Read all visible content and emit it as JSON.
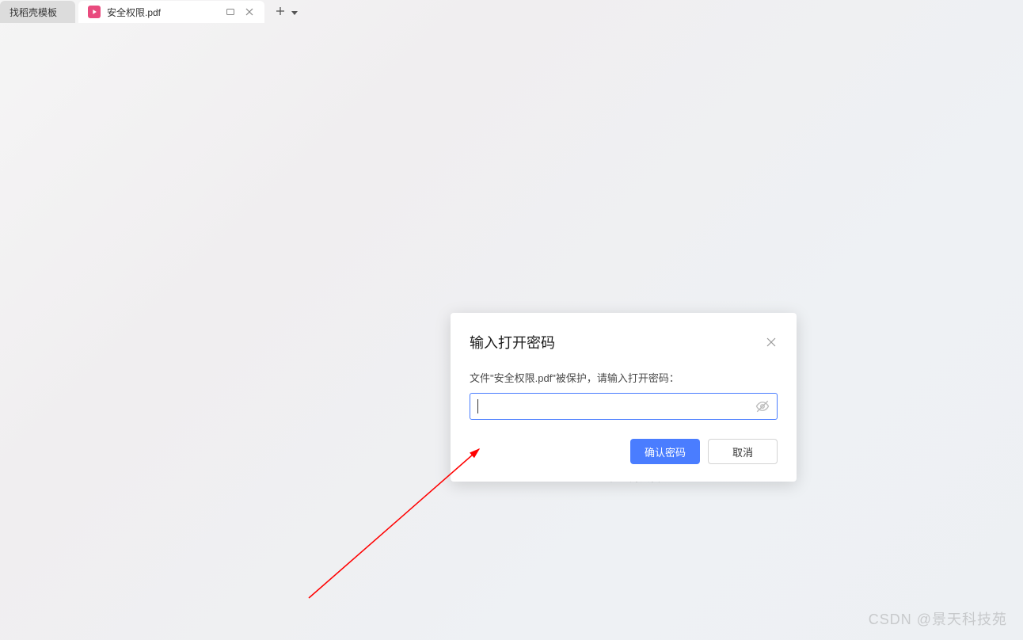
{
  "tabs": {
    "inactive_label": "找稻壳模板",
    "active_label": "安全权限.pdf"
  },
  "background": {
    "loading_text": "正在打开文档..."
  },
  "dialog": {
    "title": "输入打开密码",
    "message": "文件\"安全权限.pdf\"被保护，请输入打开密码：",
    "password_value": "",
    "confirm_label": "确认密码",
    "cancel_label": "取消"
  },
  "watermark": {
    "text": "CSDN @景天科技苑"
  }
}
